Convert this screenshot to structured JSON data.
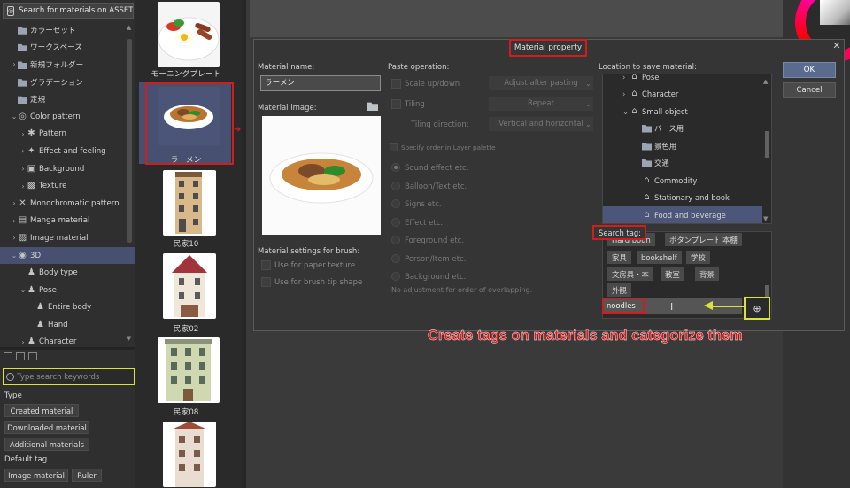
{
  "left_panel": {
    "search_assets": "Search for materials on ASSETS",
    "tree": [
      {
        "label": "カラーセット",
        "arrow": "",
        "indent": 1,
        "icon": "folder"
      },
      {
        "label": "ワークスペース",
        "arrow": "",
        "indent": 1,
        "icon": "folder"
      },
      {
        "label": "新規フォルダー",
        "arrow": ">",
        "indent": 1,
        "icon": "folder"
      },
      {
        "label": "グラデーション",
        "arrow": "",
        "indent": 1,
        "icon": "folder"
      },
      {
        "label": "定規",
        "arrow": "",
        "indent": 1,
        "icon": "folder"
      },
      {
        "label": "Color pattern",
        "arrow": "v",
        "indent": 1,
        "icon": "glyph"
      },
      {
        "label": "Pattern",
        "arrow": ">",
        "indent": 2,
        "icon": "glyph"
      },
      {
        "label": "Effect and feeling",
        "arrow": ">",
        "indent": 2,
        "icon": "glyph"
      },
      {
        "label": "Background",
        "arrow": ">",
        "indent": 2,
        "icon": "glyph"
      },
      {
        "label": "Texture",
        "arrow": ">",
        "indent": 2,
        "icon": "glyph"
      },
      {
        "label": "Monochromatic pattern",
        "arrow": ">",
        "indent": 1,
        "icon": "glyph"
      },
      {
        "label": "Manga material",
        "arrow": ">",
        "indent": 1,
        "icon": "glyph"
      },
      {
        "label": "Image material",
        "arrow": ">",
        "indent": 1,
        "icon": "glyph"
      },
      {
        "label": "3D",
        "arrow": "v",
        "indent": 1,
        "icon": "glyph",
        "selected": true
      },
      {
        "label": "Body type",
        "arrow": "",
        "indent": 2,
        "icon": "glyph"
      },
      {
        "label": "Pose",
        "arrow": "v",
        "indent": 2,
        "icon": "glyph"
      },
      {
        "label": "Entire body",
        "arrow": "",
        "indent": 3,
        "icon": "glyph"
      },
      {
        "label": "Hand",
        "arrow": "",
        "indent": 3,
        "icon": "glyph"
      },
      {
        "label": "Character",
        "arrow": ">",
        "indent": 2,
        "icon": "glyph"
      }
    ],
    "keyword_placeholder": "Type search keywords",
    "type_label": "Type",
    "type_buttons": [
      "Created material",
      "Downloaded material",
      "Additional materials"
    ],
    "default_tag_label": "Default tag",
    "default_tags": [
      "Image material",
      "Ruler"
    ]
  },
  "thumbnails": [
    {
      "caption": "モーニングプレート"
    },
    {
      "caption": "ラーメン",
      "selected": true
    },
    {
      "caption": "民家10"
    },
    {
      "caption": "民家02"
    },
    {
      "caption": "民家08"
    }
  ],
  "dialog": {
    "title": "Material property",
    "material_name_label": "Material name:",
    "material_name_value": "ラーメン",
    "material_image_label": "Material image:",
    "brush_settings_label": "Material settings for brush:",
    "paper_texture": "Use for paper texture",
    "brush_tip_shape": "Use for brush tip shape",
    "paste_operation_label": "Paste operation:",
    "scale": "Scale up/down",
    "scale_dropdown": "Adjust after pasting",
    "tiling": "Tiling",
    "tiling_dropdown": "Repeat",
    "tiling_direction_label": "Tiling direction:",
    "tiling_direction_dropdown": "Vertical and horizontal",
    "specify_order": "Specify order in Layer palette",
    "radio_options": [
      "Sound effect etc.",
      "Balloon/Text etc.",
      "Signs etc.",
      "Effect etc.",
      "Foreground etc.",
      "Person/Item etc.",
      "Background etc."
    ],
    "no_adjustment": "No adjustment for order of overlapping.",
    "location_label": "Location to save material:",
    "location_tree": [
      {
        "label": "Pose",
        "indent": 1,
        "arrow": ">"
      },
      {
        "label": "Character",
        "indent": 1,
        "arrow": ">"
      },
      {
        "label": "Small object",
        "indent": 1,
        "arrow": "v"
      },
      {
        "label": "パース用",
        "indent": 2,
        "arrow": ""
      },
      {
        "label": "景色用",
        "indent": 2,
        "arrow": ""
      },
      {
        "label": "交通",
        "indent": 2,
        "arrow": ""
      },
      {
        "label": "Commodity",
        "indent": 2,
        "arrow": ""
      },
      {
        "label": "Stationary and book",
        "indent": 2,
        "arrow": ""
      },
      {
        "label": "Food and beverage",
        "indent": 2,
        "arrow": "",
        "selected": true
      }
    ],
    "search_tag_label": "Search tag:",
    "tags_row0": [
      "Hard boun",
      "ボタンプレート",
      "本棚"
    ],
    "tags_row1": [
      "家具",
      "bookshelf",
      "学校"
    ],
    "tags_row2": [
      "文房具・本",
      "教室",
      "背景"
    ],
    "tags_row3": [
      "外観"
    ],
    "tag_input_value": "noodles",
    "ok": "OK",
    "cancel": "Cancel"
  },
  "caption": "Create tags on materials and categorize them",
  "colors": {
    "highlight_red": "#d21d1d",
    "highlight_yellow": "#d9e33b",
    "selection_blue": "#475070"
  }
}
